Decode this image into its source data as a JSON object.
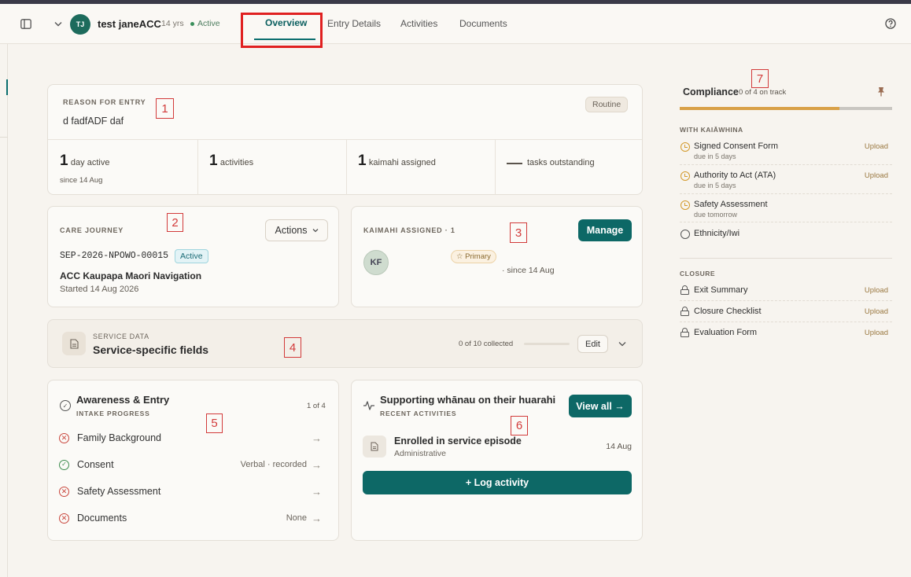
{
  "patient": {
    "initials": "TJ",
    "name": "test janeACC",
    "age": "14 yrs",
    "status": "Active"
  },
  "tabs": [
    {
      "label": "Overview"
    },
    {
      "label": "Entry Details"
    },
    {
      "label": "Activities"
    },
    {
      "label": "Documents"
    }
  ],
  "reason": {
    "label": "REASON FOR ENTRY",
    "text": "d fadfADF daf",
    "badge": "Routine"
  },
  "stats": [
    {
      "value": "1",
      "label": "day active",
      "sub": "since 14 Aug"
    },
    {
      "value": "1",
      "label": "activities"
    },
    {
      "value": "1",
      "label": "kaimahi assigned"
    },
    {
      "label": "tasks outstanding"
    }
  ],
  "care_journey": {
    "label": "CARE JOURNEY",
    "actions_label": "Actions",
    "episode_id": "SEP-2026-NPOWO-00015",
    "episode_status": "Active",
    "program": "ACC Kaupapa Maori Navigation",
    "started": "Started 14 Aug 2026"
  },
  "kaimahi": {
    "label": "KAIMAHI ASSIGNED · 1",
    "manage_label": "Manage",
    "initials": "KF",
    "role_badge": "Primary",
    "since": "· since 14 Aug"
  },
  "service_data": {
    "label": "SERVICE DATA",
    "title": "Service-specific fields",
    "collected": "0 of 10 collected",
    "collected_fraction": 0,
    "edit_label": "Edit"
  },
  "intake": {
    "title": "Awareness & Entry",
    "subtitle": "INTAKE PROGRESS",
    "progress": "1 of 4",
    "items": [
      {
        "label": "Family Background",
        "status": "incomplete",
        "detail": ""
      },
      {
        "label": "Consent",
        "status": "complete",
        "detail": "Verbal · recorded"
      },
      {
        "label": "Safety Assessment",
        "status": "incomplete",
        "detail": ""
      },
      {
        "label": "Documents",
        "status": "incomplete",
        "detail": "None"
      }
    ]
  },
  "activities": {
    "title": "Supporting whānau on their huarahi",
    "subtitle": "RECENT ACTIVITIES",
    "view_all_label": "View all →",
    "items": [
      {
        "title": "Enrolled in service episode",
        "category": "Administrative",
        "date": "14 Aug"
      }
    ],
    "log_label": "+ Log activity"
  },
  "compliance": {
    "title": "Compliance",
    "summary": "0 of 4 on track",
    "progress_fraction": 0.75,
    "sections": [
      {
        "label": "WITH KAIĀWHINA",
        "items": [
          {
            "title": "Signed Consent Form",
            "due": "due in 5 days",
            "action": "Upload",
            "icon": "clock-icon"
          },
          {
            "title": "Authority to Act (ATA)",
            "due": "due in 5 days",
            "action": "Upload",
            "icon": "clock-icon"
          },
          {
            "title": "Safety Assessment",
            "due": "due tomorrow",
            "action": "",
            "icon": "clock-icon"
          },
          {
            "title": "Ethnicity/Iwi",
            "due": "",
            "action": "",
            "icon": "circle-icon"
          }
        ]
      },
      {
        "label": "CLOSURE",
        "items": [
          {
            "title": "Exit Summary",
            "action": "Upload",
            "icon": "lock-icon"
          },
          {
            "title": "Closure Checklist",
            "action": "Upload",
            "icon": "lock-icon"
          },
          {
            "title": "Evaluation Form",
            "action": "Upload",
            "icon": "lock-icon"
          }
        ]
      }
    ]
  },
  "annotations": [
    "1",
    "2",
    "3",
    "4",
    "5",
    "6",
    "7"
  ],
  "colors": {
    "teal": "#0d6866",
    "highlight_red": "#e02020",
    "compliance_orange": "#d9a148"
  }
}
